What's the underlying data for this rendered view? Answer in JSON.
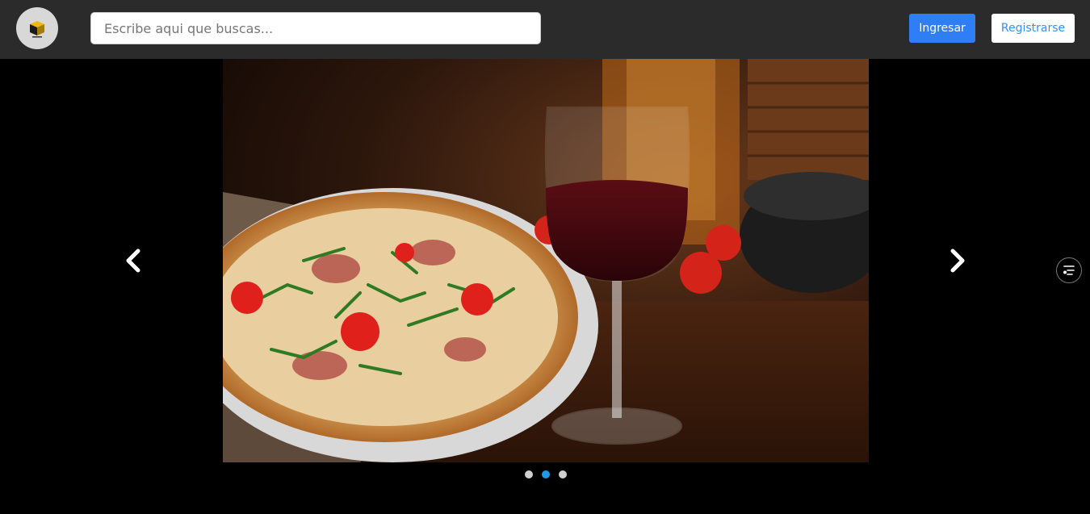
{
  "header": {
    "logo_icon": "vendisco-logo",
    "search": {
      "placeholder": "Escribe aqui que buscas...",
      "value": ""
    },
    "login_label": "Ingresar",
    "register_label": "Registrarse"
  },
  "carousel": {
    "slide_image": "pizza-and-red-wine-photo",
    "prev_icon": "chevron-left-icon",
    "next_icon": "chevron-right-icon",
    "slide_count": 3,
    "active_index": 1
  },
  "floating": {
    "filter_icon": "filter-list-icon"
  },
  "colors": {
    "header_bg": "#2b2b2b",
    "primary": "#2f7ef6",
    "active_dot": "#1e9be8",
    "page_bg": "#000000"
  }
}
